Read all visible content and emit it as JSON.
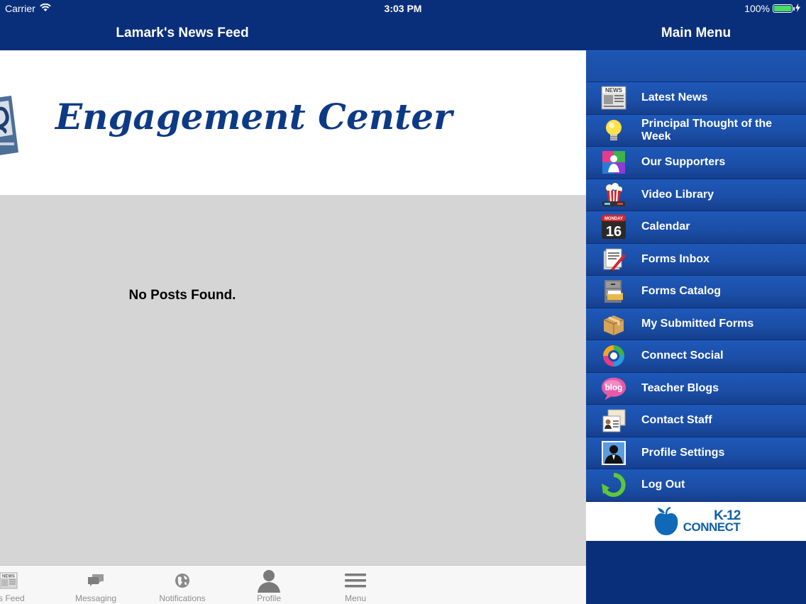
{
  "status_bar": {
    "carrier": "Carrier",
    "time": "3:03 PM",
    "battery_percent": "100%",
    "battery_level": 1.0
  },
  "news_feed": {
    "title": "Lamark's News Feed",
    "banner_text": "Engagement Center",
    "empty_message": "No Posts Found."
  },
  "tab_bar": {
    "items": [
      {
        "label": "ws Feed",
        "icon": "news-icon"
      },
      {
        "label": "Messaging",
        "icon": "chat-bubbles-icon"
      },
      {
        "label": "Notifications",
        "icon": "globe-icon"
      },
      {
        "label": "Profile",
        "icon": "person-icon"
      },
      {
        "label": "Menu",
        "icon": "hamburger-icon"
      }
    ]
  },
  "main_menu": {
    "title": "Main Menu",
    "items": [
      {
        "label": "Latest News",
        "icon": "newspaper-icon"
      },
      {
        "label": "Principal Thought of the Week",
        "icon": "lightbulb-icon"
      },
      {
        "label": "Our Supporters",
        "icon": "supporters-icon"
      },
      {
        "label": "Video Library",
        "icon": "popcorn-icon"
      },
      {
        "label": "Calendar",
        "icon": "calendar-icon",
        "calendar_day": "MONDAY",
        "calendar_date": "16"
      },
      {
        "label": "Forms Inbox",
        "icon": "forms-inbox-icon"
      },
      {
        "label": "Forms Catalog",
        "icon": "file-cabinet-icon"
      },
      {
        "label": "My Submitted Forms",
        "icon": "package-icon"
      },
      {
        "label": "Connect Social",
        "icon": "social-cycle-icon"
      },
      {
        "label": "Teacher Blogs",
        "icon": "blog-bubble-icon",
        "badge_text": "blog"
      },
      {
        "label": "Contact Staff",
        "icon": "contact-cards-icon"
      },
      {
        "label": "Profile Settings",
        "icon": "profile-silhouette-icon"
      },
      {
        "label": "Log Out",
        "icon": "logout-arrow-icon"
      }
    ],
    "footer_logo": {
      "line1": "K-12",
      "line2": "CONNECT"
    }
  },
  "colors": {
    "nav_blue": "#0a2f7a",
    "menu_item_blue": "#1b4fa8",
    "content_gray": "#d6d5d6",
    "banner_text_blue": "#0d3a86"
  }
}
